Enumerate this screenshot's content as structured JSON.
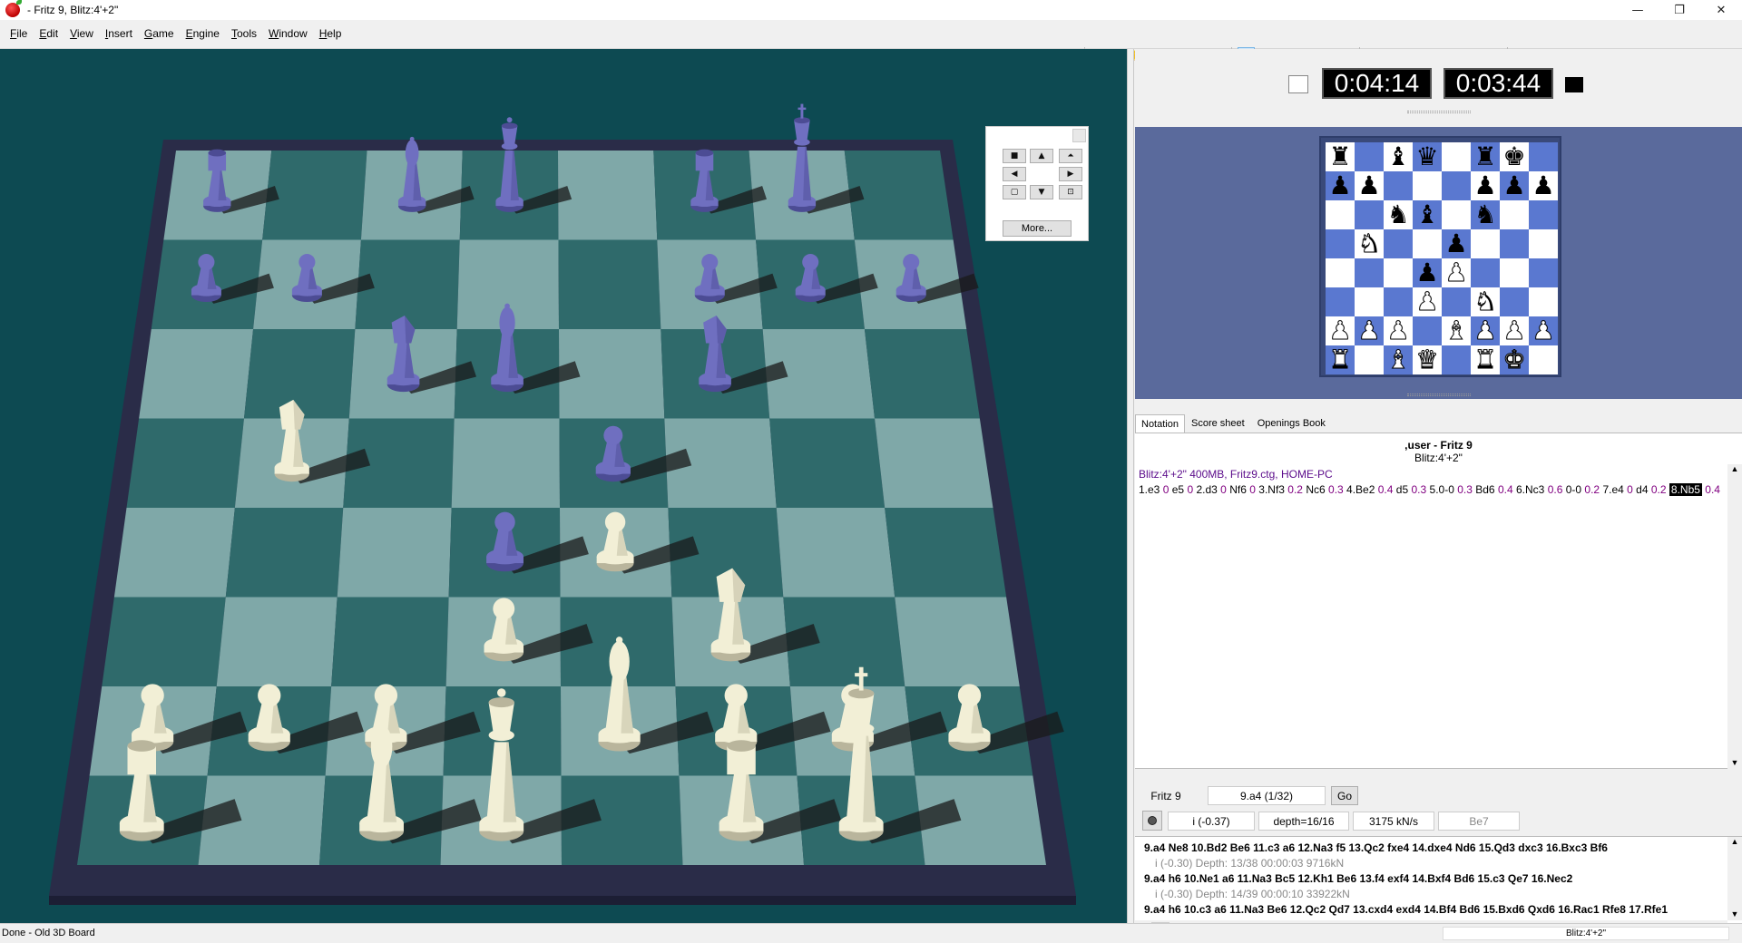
{
  "titlebar": {
    "title": "- Fritz 9, Blitz:4'+2\"",
    "minimize": "—",
    "maximize": "❐",
    "close": "✕"
  },
  "menu": [
    {
      "u": "F",
      "rest": "ile"
    },
    {
      "u": "E",
      "rest": "dit"
    },
    {
      "u": "V",
      "rest": "iew"
    },
    {
      "u": "I",
      "rest": "nsert"
    },
    {
      "u": "G",
      "rest": "ame"
    },
    {
      "u": "E",
      "rest": "ngine"
    },
    {
      "u": "T",
      "rest": "ools"
    },
    {
      "u": "W",
      "rest": "indow"
    },
    {
      "u": "H",
      "rest": "elp"
    }
  ],
  "toolbar": {
    "nav": [
      {
        "name": "first-move-icon",
        "g": "⏮"
      },
      {
        "name": "prev-move-icon",
        "g": "◁"
      },
      {
        "name": "takeback-icon",
        "g": "↶"
      },
      {
        "name": "next-move-icon",
        "g": "▷"
      },
      {
        "name": "last-move-icon",
        "g": "⏭"
      }
    ],
    "g1": [
      {
        "name": "open-folder-icon",
        "g": "📂"
      },
      {
        "name": "globe-icon",
        "g": "🌐"
      },
      {
        "name": "coin-icon",
        "g": "🪙"
      },
      {
        "name": "piece-tool-icon",
        "g": "♗"
      },
      {
        "name": "piece-set-icon",
        "g": "♟"
      },
      {
        "name": "ball-icon",
        "g": "⚽"
      },
      {
        "name": "flag-icon",
        "g": "⚑"
      }
    ],
    "g2": [
      {
        "name": "clock-icon",
        "g": "⏱",
        "active": true
      },
      {
        "name": "pawn-icon",
        "g": "♙"
      },
      {
        "name": "board-edit-icon",
        "g": "▦"
      },
      {
        "name": "knight-icon",
        "g": "♘"
      },
      {
        "name": "bishop-icon",
        "g": "♝"
      },
      {
        "name": "figure-icon",
        "g": "♛"
      }
    ],
    "g3": [
      {
        "name": "key-icon",
        "g": "⚿"
      },
      {
        "name": "book-icon",
        "g": "📖"
      },
      {
        "name": "pen-icon",
        "g": "✎"
      },
      {
        "name": "grid-icon",
        "g": "⊞"
      },
      {
        "name": "table-icon",
        "g": "▤"
      },
      {
        "name": "engine-icon",
        "g": "⚙"
      },
      {
        "name": "monitor-icon",
        "g": "🖥"
      }
    ],
    "g4": [
      {
        "name": "save-icon",
        "g": "💾"
      },
      {
        "name": "settings-icon",
        "g": "⚙"
      },
      {
        "name": "cube-icon",
        "g": "⬢"
      },
      {
        "name": "arrow-icon",
        "g": "↗"
      },
      {
        "name": "tools-icon",
        "g": "✂"
      }
    ]
  },
  "board_controls": {
    "more_label": "More...",
    "buttons": [
      {
        "name": "stop-button",
        "g": "■"
      },
      {
        "name": "up-button",
        "g": "▲"
      },
      {
        "name": "raise-button",
        "g": "⏶"
      },
      {
        "name": "left-button",
        "g": "◀"
      },
      {
        "name": "right-button",
        "g": "▶"
      },
      {
        "name": "square-button",
        "g": "▢"
      },
      {
        "name": "down-button",
        "g": "▼"
      },
      {
        "name": "center-button",
        "g": "⊡"
      }
    ]
  },
  "clocks": {
    "white": "0:04:14",
    "black": "0:03:44"
  },
  "diagram": [
    [
      "r",
      "",
      "b",
      "q",
      "",
      "r",
      "k",
      ""
    ],
    [
      "p",
      "p",
      "",
      "",
      "",
      "p",
      "p",
      "p"
    ],
    [
      "",
      "",
      "n",
      "b",
      "",
      "n",
      "",
      ""
    ],
    [
      "",
      "N",
      "",
      "",
      "p",
      "",
      "",
      ""
    ],
    [
      "",
      "",
      "",
      "p",
      "P",
      "",
      "",
      ""
    ],
    [
      "",
      "",
      "",
      "P",
      "",
      "N",
      "",
      ""
    ],
    [
      "P",
      "P",
      "P",
      "",
      "B",
      "P",
      "P",
      "P"
    ],
    [
      "R",
      "",
      "B",
      "Q",
      "",
      "R",
      "K",
      ""
    ]
  ],
  "tabs": [
    "Notation",
    "Score sheet",
    "Openings Book"
  ],
  "notation": {
    "header_line1": ",user - Fritz 9",
    "header_line2": "Blitz:4'+2\"",
    "meta": "Blitz:4'+2\"  400MB, Fritz9.ctg, HOME-PC",
    "moves": [
      {
        "m": "1.e3",
        "e": "0"
      },
      {
        "m": "e5",
        "e": "0"
      },
      {
        "m": "2.d3",
        "e": "0"
      },
      {
        "m": "Nf6",
        "e": "0"
      },
      {
        "m": "3.Nf3",
        "e": "0.2"
      },
      {
        "m": "Nc6",
        "e": "0.3"
      },
      {
        "m": "4.Be2",
        "e": "0.4"
      },
      {
        "m": "d5",
        "e": "0.3"
      },
      {
        "m": "5.0-0",
        "e": "0.3"
      },
      {
        "m": "Bd6",
        "e": "0.4"
      },
      {
        "m": "6.Nc3",
        "e": "0.6"
      },
      {
        "m": "0-0",
        "e": "0.2"
      },
      {
        "m": "7.e4",
        "e": "0"
      },
      {
        "m": "d4",
        "e": "0.2"
      },
      {
        "m": "8.Nb5",
        "e": "0.4",
        "cur": true
      }
    ]
  },
  "engine": {
    "name": "Fritz 9",
    "move": "9.a4 (1/32)",
    "go_label": "Go",
    "eval": "i (-0.37)",
    "depth": "depth=16/16",
    "speed": "3175 kN/s",
    "best": "Be7",
    "lines": [
      {
        "main": "9.a4 Ne8 10.Bd2 Be6 11.c3 a6 12.Na3 f5 13.Qc2 fxe4 14.dxe4 Nd6 15.Qd3 dxc3 16.Bxc3 Bf6",
        "stat": "i  (-0.30)  Depth: 13/38   00:00:03  9716kN"
      },
      {
        "main": "9.a4 h6 10.Ne1 a6 11.Na3 Bc5 12.Kh1 Be6 13.f4 exf4 14.Bxf4 Bd6 15.c3 Qe7 16.Nec2",
        "stat": "i  (-0.30)  Depth: 14/39   00:00:10  33922kN"
      },
      {
        "main": "9.a4 h6 10.c3 a6 11.Na3 Be6 12.Qc2 Qd7 13.cxd4 exd4 14.Bf4 Bd6 15.Bxd6 Qxd6 16.Rac1 Rfe8 17.Rfe1",
        "stat": "i  (-0.37)  Depth: 15/39   00:00:19  60225kN"
      }
    ]
  },
  "status": {
    "left": "Done - Old 3D Board",
    "right": "Blitz:4'+2\""
  },
  "colors": {
    "board_bg": "#0d4a52",
    "board_light": "#7fa8a8",
    "board_dark": "#2f6a6b",
    "black_piece": "#6f6fc0",
    "white_piece": "#f2efd6",
    "diagram_dark": "#5a78d0"
  }
}
